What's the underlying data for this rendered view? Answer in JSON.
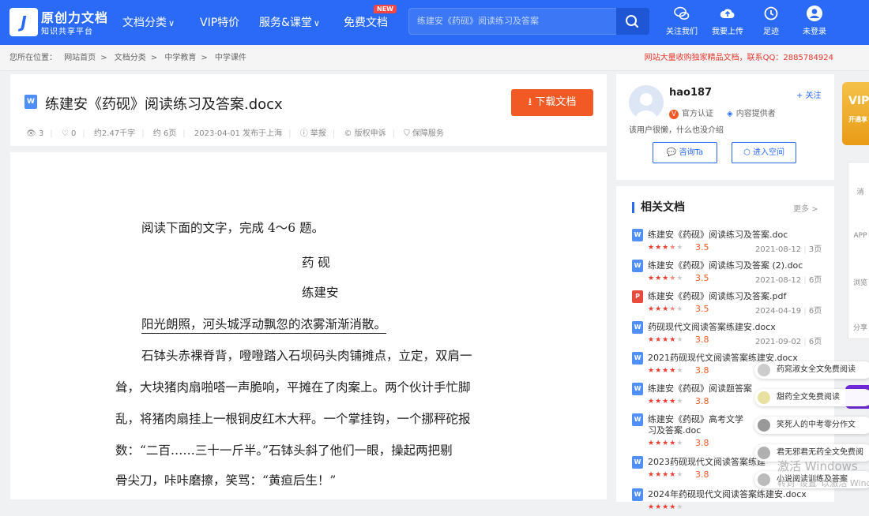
{
  "header": {
    "logo_title": "原创力文档",
    "logo_sub": "知识共享平台",
    "nav": [
      {
        "label": "文档分类"
      },
      {
        "label": "VIP特价"
      },
      {
        "label": "服务&课堂"
      },
      {
        "label": "免费文档",
        "badge": "NEW"
      }
    ],
    "search_placeholder": "练建安《药砚》阅读练习及答案",
    "tools": [
      {
        "label": "关注我们",
        "icon": "wechat-icon"
      },
      {
        "label": "我要上传",
        "icon": "upload-cloud-icon"
      },
      {
        "label": "足迹",
        "icon": "history-icon"
      },
      {
        "label": "未登录",
        "icon": "user-icon"
      }
    ]
  },
  "breadcrumb": {
    "prefix": "您所在位置：",
    "items": [
      "网站首页",
      "文档分类",
      "中学教育",
      "中学课件"
    ],
    "separator": ">",
    "notice": "网站大量收购独家精品文档，联系QQ：2885784924"
  },
  "doc": {
    "title": "练建安《药砚》阅读练习及答案.docx",
    "download_label": "下载文档",
    "meta": {
      "views": "3",
      "likes": "0",
      "words": "约2.47千字",
      "pages": "约 6页",
      "published": "2023-04-01 发布于上海",
      "report": "举报",
      "copyright": "版权申诉",
      "guarantee": "保障服务"
    },
    "content": {
      "intro": "阅读下面的文字，完成  4～6 题。",
      "title": "药    砚",
      "author": "练建安",
      "p1": "阳光朗照，河头城浮动飘忽的浓雾渐渐消散。",
      "p2_l1": "石钵头赤裸脊背，噔噔踏入石坝码头肉铺摊点，立定，双肩一",
      "p2_l2": "耸，大块猪肉扇啪嗒一声脆响，平摊在了肉案上。两个伙计手忙脚",
      "p2_l3": "乱，将猪肉扇挂上一根铜皮红木大秤。一个掌挂钩，一个挪秤砣报",
      "p2_l4": "数：“二百……三十一斤半。”石钵头斜了他们一眼，操起两把剔",
      "p2_l5": "骨尖刀，咔咔磨擦，笑骂：“黄疸后生！”"
    }
  },
  "author": {
    "name": "hao187",
    "follow": "+ 关注",
    "cert": "官方认证",
    "provider": "内容提供者",
    "bio": "该用户很懒，什么也没介绍",
    "consult": "咨询Ta",
    "space": "进入空间"
  },
  "related": {
    "title": "相关文档",
    "more": "更多 >",
    "items": [
      {
        "type": "W",
        "color": "#4f8ff7",
        "title": "练建安《药砚》阅读练习及答案.doc",
        "stars": 3.5,
        "score": "3.5",
        "date": "2021-08-12",
        "pages": "3页"
      },
      {
        "type": "W",
        "color": "#4f8ff7",
        "title": "练建安《药砚》阅读练习及答案 (2).doc",
        "stars": 3.5,
        "score": "3.5",
        "date": "2021-08-12",
        "pages": "6页"
      },
      {
        "type": "P",
        "color": "#e84b3c",
        "title": "练建安《药砚》阅读练习及答案.pdf",
        "stars": 3.5,
        "score": "3.5",
        "date": "2024-04-19",
        "pages": "6页"
      },
      {
        "type": "W",
        "color": "#4f8ff7",
        "title": "药砚现代文阅读答案练建安.docx",
        "stars": 4,
        "score": "3.8",
        "date": "2021-09-02",
        "pages": "6页"
      },
      {
        "type": "W",
        "color": "#4f8ff7",
        "title": "2021药砚现代文阅读答案练建安.docx",
        "stars": 4,
        "score": "3.8",
        "date": "",
        "pages": ""
      },
      {
        "type": "W",
        "color": "#4f8ff7",
        "title": "练建安《药砚》阅读题答案",
        "stars": 4,
        "score": "3.8",
        "date": "",
        "pages": ""
      },
      {
        "type": "W",
        "color": "#4f8ff7",
        "title": "练建安《药砚》高考文学",
        "title2": "习及答案.doc",
        "stars": 4,
        "score": "3.8",
        "date": "",
        "pages": ""
      },
      {
        "type": "W",
        "color": "#4f8ff7",
        "title": "2023药砚现代文阅读答案练建",
        "stars": 4,
        "score": "3.8",
        "date": "",
        "pages": ""
      },
      {
        "type": "W",
        "color": "#4f8ff7",
        "title": "2024年药砚现代文阅读答案练建安.docx",
        "stars": 4,
        "score": "",
        "date": "",
        "pages": ""
      }
    ]
  },
  "floating": {
    "vip": "VIP",
    "vip_sub": "开通享",
    "side_items": [
      "消",
      "APP",
      "浏览",
      "分享"
    ],
    "suggestions": [
      "药窕淑女全文免费阅读",
      "甜药全文免费阅读",
      "笑死人的中考零分作文",
      "君无邪君无药全文免费阅",
      "小说阅读训练及答案"
    ],
    "watermark": "激活 Windows",
    "watermark2": "转到“设置”以激活 Windows。"
  }
}
